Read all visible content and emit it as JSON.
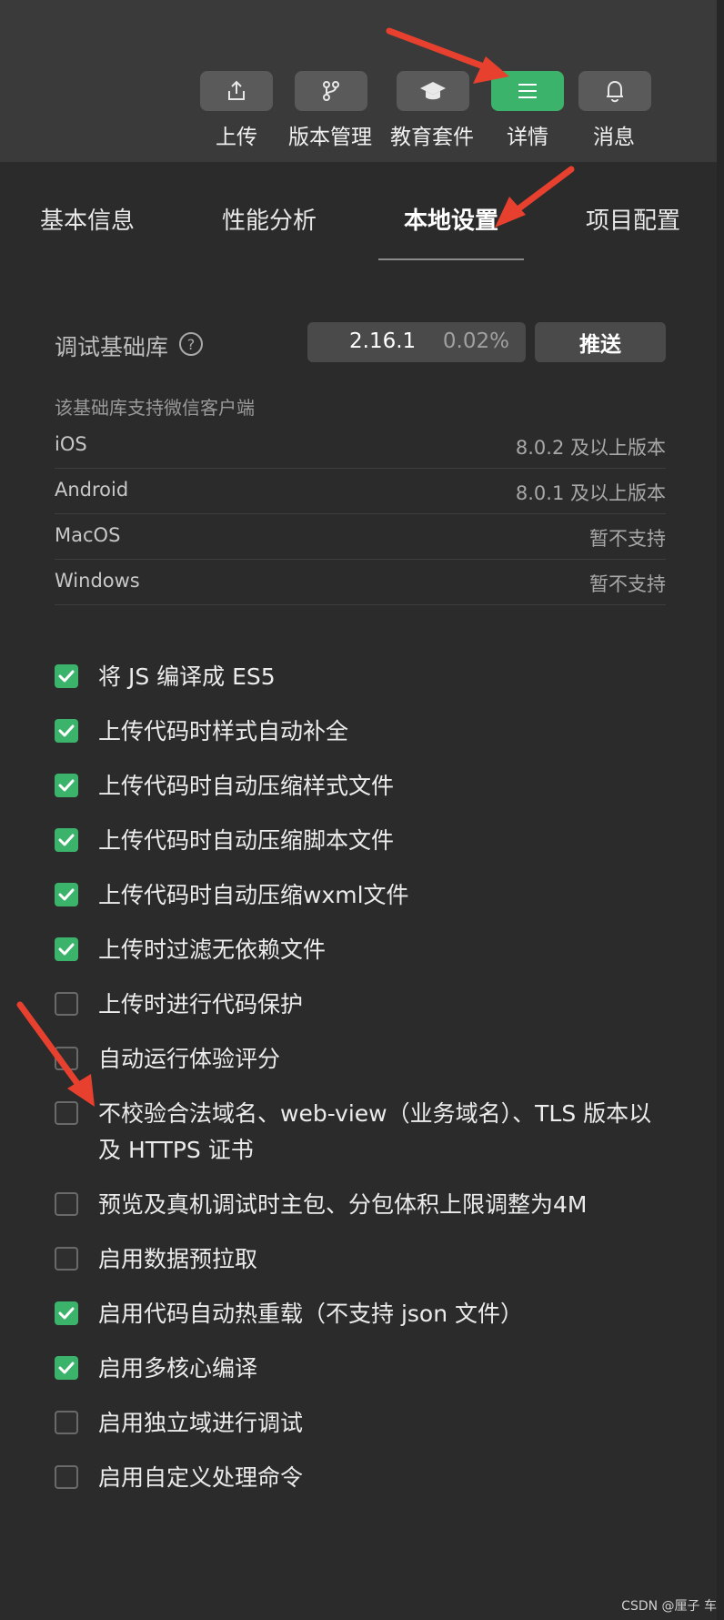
{
  "toolbar": {
    "buttons": [
      {
        "label": "上传",
        "icon": "upload-icon",
        "active": false
      },
      {
        "label": "版本管理",
        "icon": "branch-icon",
        "active": false
      },
      {
        "label": "教育套件",
        "icon": "graduation-cap-icon",
        "active": false
      },
      {
        "label": "详情",
        "icon": "menu-icon",
        "active": true
      },
      {
        "label": "消息",
        "icon": "bell-icon",
        "active": false
      }
    ]
  },
  "tabs": [
    {
      "label": "基本信息"
    },
    {
      "label": "性能分析"
    },
    {
      "label": "本地设置",
      "active": true
    },
    {
      "label": "项目配置"
    }
  ],
  "debug_lib": {
    "label": "调试基础库",
    "version": "2.16.1",
    "share": "0.02%",
    "push_label": "推送"
  },
  "support": {
    "heading": "该基础库支持微信客户端",
    "platforms": [
      {
        "name": "iOS",
        "value": "8.0.2 及以上版本"
      },
      {
        "name": "Android",
        "value": "8.0.1 及以上版本"
      },
      {
        "name": "MacOS",
        "value": "暂不支持"
      },
      {
        "name": "Windows",
        "value": "暂不支持"
      }
    ]
  },
  "options": [
    {
      "label": "将 JS 编译成 ES5",
      "checked": true
    },
    {
      "label": "上传代码时样式自动补全",
      "checked": true
    },
    {
      "label": "上传代码时自动压缩样式文件",
      "checked": true
    },
    {
      "label": "上传代码时自动压缩脚本文件",
      "checked": true
    },
    {
      "label": "上传代码时自动压缩wxml文件",
      "checked": true
    },
    {
      "label": "上传时过滤无依赖文件",
      "checked": true
    },
    {
      "label": "上传时进行代码保护",
      "checked": false
    },
    {
      "label": "自动运行体验评分",
      "checked": false
    },
    {
      "label": "不校验合法域名、web-view（业务域名）、TLS 版本以及 HTTPS 证书",
      "checked": false
    },
    {
      "label": "预览及真机调试时主包、分包体积上限调整为4M",
      "checked": false
    },
    {
      "label": "启用数据预拉取",
      "checked": false
    },
    {
      "label": "启用代码自动热重载（不支持 json 文件）",
      "checked": true
    },
    {
      "label": "启用多核心编译",
      "checked": true
    },
    {
      "label": "启用独立域进行调试",
      "checked": false
    },
    {
      "label": "启用自定义处理命令",
      "checked": false
    }
  ],
  "watermark": "CSDN @厘子 车",
  "colors": {
    "accent_green": "#3bb36a",
    "annotation_red": "#e8402e"
  }
}
